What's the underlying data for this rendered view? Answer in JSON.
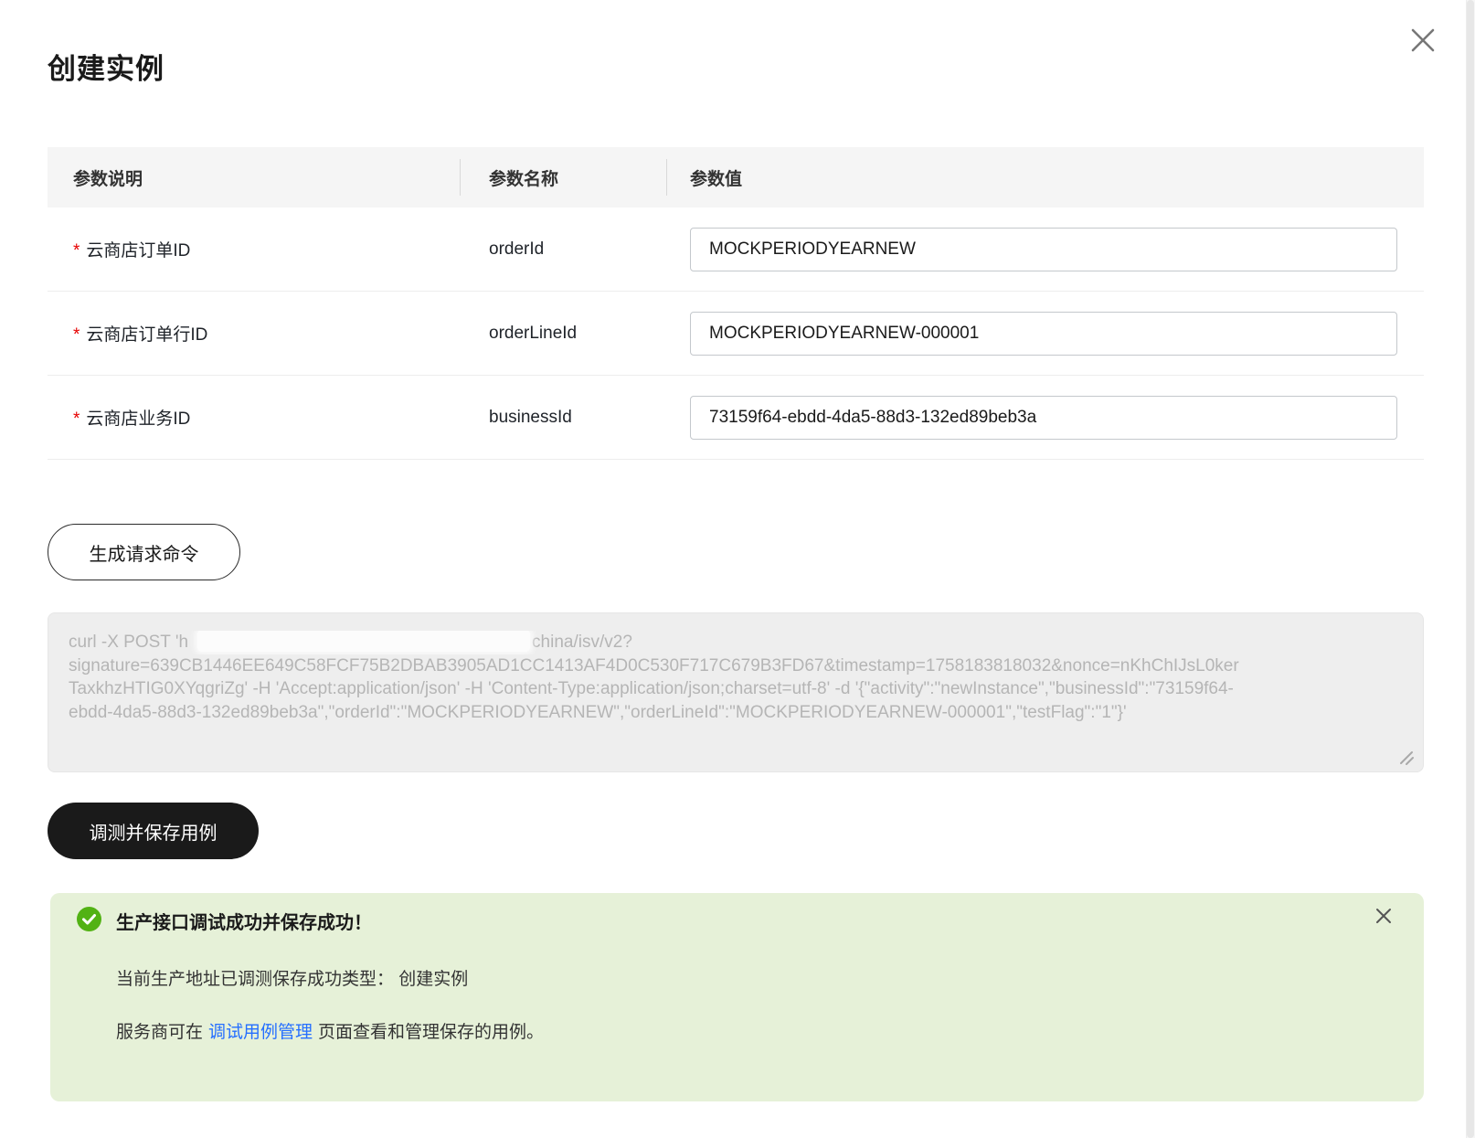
{
  "dialog": {
    "title": "创建实例"
  },
  "table": {
    "headers": [
      "参数说明",
      "参数名称",
      "参数值"
    ],
    "rows": [
      {
        "required": "*",
        "label": "云商店订单ID",
        "name": "orderId",
        "value": "MOCKPERIODYEARNEW"
      },
      {
        "required": "*",
        "label": "云商店订单行ID",
        "name": "orderLineId",
        "value": "MOCKPERIODYEARNEW-000001"
      },
      {
        "required": "*",
        "label": "云商店业务ID",
        "name": "businessId",
        "value": "73159f64-ebdd-4da5-88d3-132ed89beb3a"
      }
    ]
  },
  "actions": {
    "generate_button": "生成请求命令",
    "debug_save_button": "调测并保存用例"
  },
  "request_command": {
    "line1_before": "curl -X POST 'h",
    "line1_after": "china/isv/v2?",
    "line2": "signature=639CB1446EE649C58FCF75B2DBAB3905AD1CC1413AF4D0C530F717C679B3FD67&timestamp=1758183818032&nonce=nKhChIJsL0ker",
    "line3": "TaxkhzHTIG0XYqgriZg' -H 'Accept:application/json' -H 'Content-Type:application/json;charset=utf-8' -d '{\"activity\":\"newInstance\",\"businessId\":\"73159f64-",
    "line4": "ebdd-4da5-88d3-132ed89beb3a\",\"orderId\":\"MOCKPERIODYEARNEW\",\"orderLineId\":\"MOCKPERIODYEARNEW-000001\",\"testFlag\":\"1\"}'"
  },
  "alert": {
    "title": "生产接口调试成功并保存成功！",
    "line1": "当前生产地址已调测保存成功类型： 创建实例",
    "line2_before": "服务商可在",
    "line2_link": "调试用例管理",
    "line2_after": "页面查看和管理保存的用例。"
  },
  "colors": {
    "accent_link": "#256fff",
    "success_icon": "#52b214",
    "alert_background": "#e6f1d8",
    "required_red": "#e60000",
    "primary_button": "#1a1a1a"
  }
}
